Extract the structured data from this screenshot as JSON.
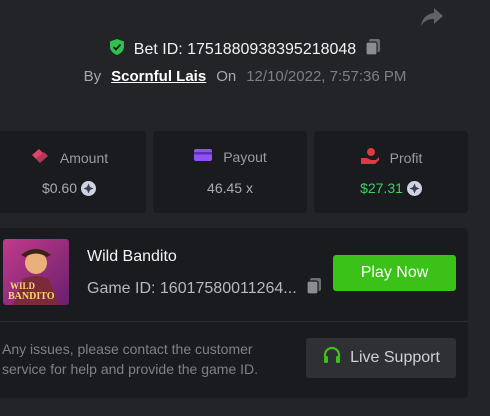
{
  "header": {
    "bet_id_label": "Bet ID: 1751880938395218048",
    "by_label": "By",
    "username": "Scornful Lais",
    "on_label": "On",
    "datetime": "12/10/2022, 7:57:36 PM"
  },
  "stats": [
    {
      "label": "Amount",
      "value": "$0.60",
      "icon": "money-icon",
      "color": "#e0446c"
    },
    {
      "label": "Payout",
      "value": "46.45 x",
      "icon": "wallet-icon",
      "color": "#8e52f5"
    },
    {
      "label": "Profit",
      "value": "$27.31",
      "icon": "hand-coin-icon",
      "color": "#e0393e"
    }
  ],
  "game": {
    "title": "Wild Bandito",
    "game_id": "Game ID: 16017580011264...",
    "thumb_text_1": "WILD",
    "thumb_text_2": "BANDITO",
    "play_label": "Play Now"
  },
  "support": {
    "help_text": "Any issues, please contact the customer service for help and provide the game ID.",
    "live_label": "Live Support"
  },
  "colors": {
    "background": "#232427",
    "card": "#1a1b1e",
    "accent_green": "#3bc117",
    "profit_green": "#3ed160"
  }
}
